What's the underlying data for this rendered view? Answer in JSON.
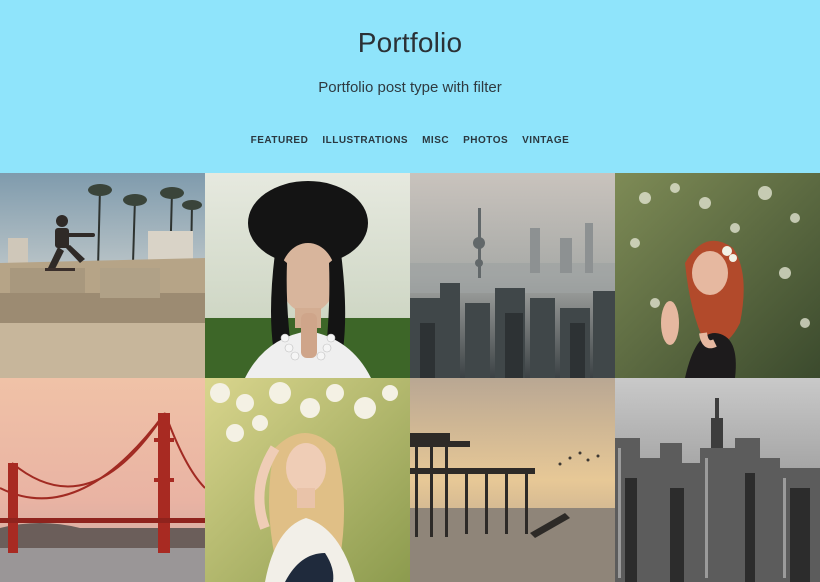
{
  "header": {
    "title": "Portfolio",
    "subtitle": "Portfolio post type with filter"
  },
  "filters": [
    "FEATURED",
    "ILLUSTRATIONS",
    "MISC",
    "PHOTOS",
    "VINTAGE"
  ],
  "colors": {
    "header_bg": "#8fe4fb",
    "text_dark": "#2b3136"
  },
  "gallery": [
    {
      "subject": "skateboarder-palms"
    },
    {
      "subject": "woman-portrait-black-hair"
    },
    {
      "subject": "city-skyline-fog"
    },
    {
      "subject": "red-hair-woman-flowers"
    },
    {
      "subject": "golden-gate-bridge"
    },
    {
      "subject": "blonde-woman-white-flowers"
    },
    {
      "subject": "pier-sunset"
    },
    {
      "subject": "new-york-bw"
    }
  ]
}
